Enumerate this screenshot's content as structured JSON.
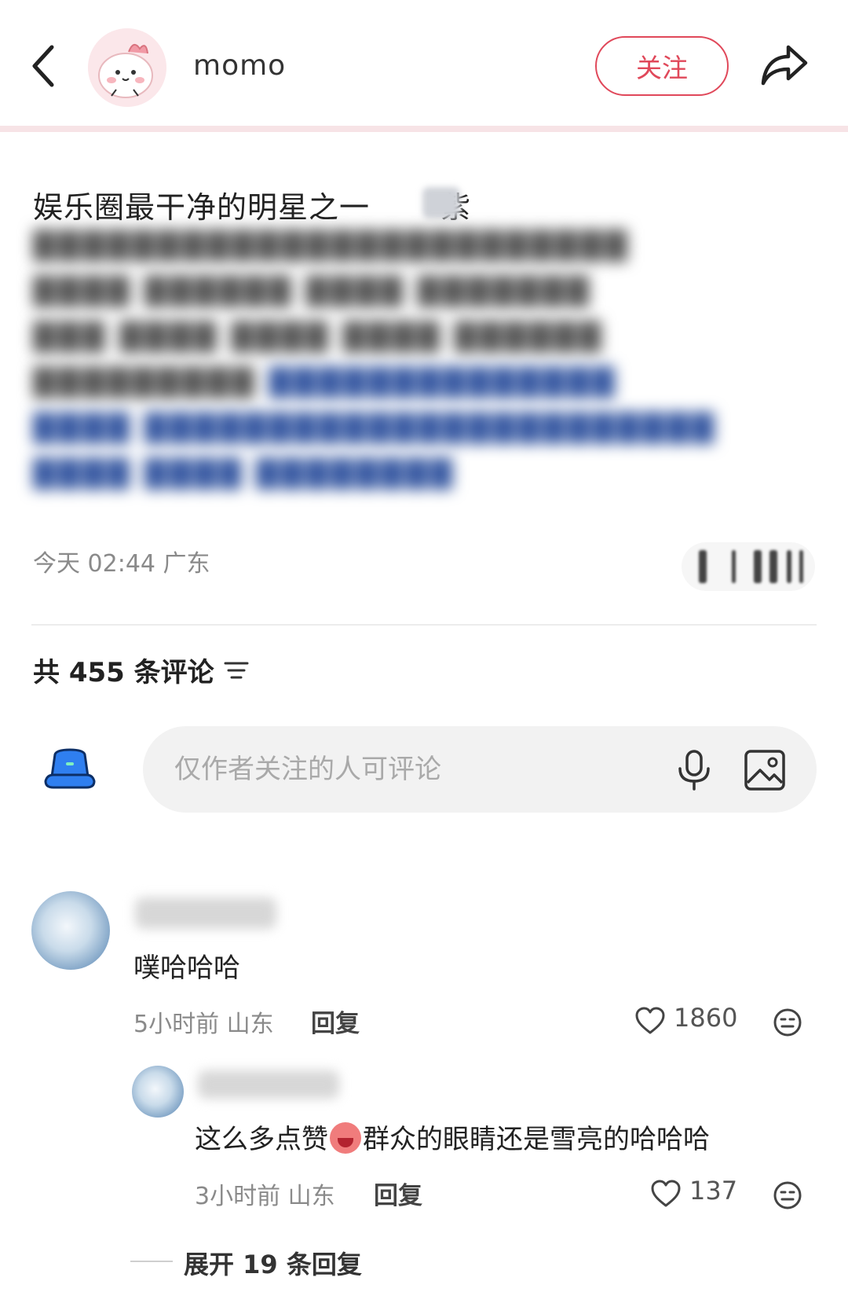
{
  "header": {
    "back_icon": "chevron-left-icon",
    "username": "momo",
    "follow_label": "关注",
    "share_icon": "share-arrow-icon"
  },
  "post": {
    "title_part1": "娱乐圈最干净的明星之一",
    "title_part2": "紫",
    "meta": "今天 02:44 广东"
  },
  "comments_section": {
    "count_label": "共 455 条评论",
    "sort_icon": "sort-icon",
    "input_placeholder": "仅作者关注的人可评论",
    "mic_icon": "microphone-icon",
    "image_icon": "image-icon"
  },
  "comments": [
    {
      "text": "噗哈哈哈",
      "time_location": "5小时前 山东",
      "reply_label": "回复",
      "likes": "1860"
    }
  ],
  "replies": [
    {
      "text_before_emoji": "这么多点赞",
      "text_after_emoji": "群众的眼睛还是雪亮的哈哈哈",
      "time_location": "3小时前 山东",
      "reply_label": "回复",
      "likes": "137"
    }
  ],
  "expand_label": "展开 19 条回复",
  "colors": {
    "accent": "#e0485a",
    "header_divider": "#f7e3e6",
    "input_bg": "#f2f2f2",
    "meta_text": "#8a8a8a"
  }
}
